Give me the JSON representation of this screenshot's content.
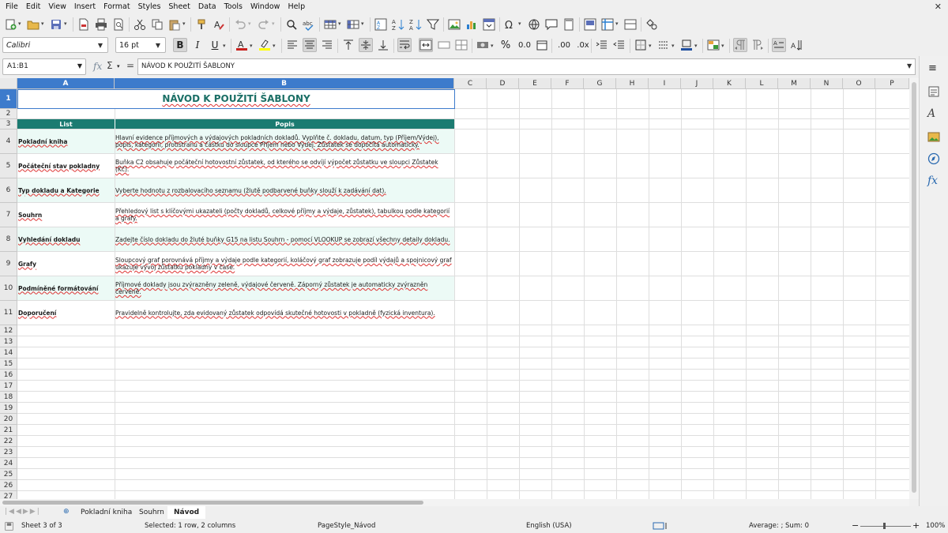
{
  "menu": [
    "File",
    "Edit",
    "View",
    "Insert",
    "Format",
    "Styles",
    "Sheet",
    "Data",
    "Tools",
    "Window",
    "Help"
  ],
  "font": {
    "name": "Calibri",
    "size": "16 pt"
  },
  "formula_bar": {
    "cell_ref": "A1:B1",
    "content": "NÁVOD K POUŽITÍ ŠABLONY"
  },
  "columns": [
    "A",
    "B",
    "C",
    "D",
    "E",
    "F",
    "G",
    "H",
    "I",
    "J",
    "K",
    "L",
    "M",
    "N",
    "O",
    "P"
  ],
  "rows": [
    "1",
    "2",
    "3",
    "4",
    "5",
    "6",
    "7",
    "8",
    "9",
    "10",
    "11",
    "12",
    "13",
    "14",
    "15",
    "16",
    "17",
    "18",
    "19",
    "20",
    "21",
    "22",
    "23",
    "24",
    "25",
    "26",
    "27"
  ],
  "sheet": {
    "title": "NÁVOD K POUŽITÍ ŠABLONY",
    "header": {
      "list": "List",
      "popis": "Popis"
    },
    "entries": [
      {
        "list": "Pokladní kniha",
        "popis": "Hlavní evidence příjmových a výdajových pokladních dokladů. Vyplňte č. dokladu, datum, typ (Příjem/Výdej), popis, kategorii, protistranu a částku do sloupce Příjem nebo Výdej. Zůstatek se dopočítá automaticky."
      },
      {
        "list": "Počáteční stav pokladny",
        "popis": "Buňka C2 obsahuje počáteční hotovostní zůstatek, od kterého se odvíjí výpočet zůstatku ve sloupci Zůstatek (Kč)."
      },
      {
        "list": "Typ dokladu a Kategorie",
        "popis": "Vyberte hodnotu z rozbalovacího seznamu (žlutě podbarvené buňky slouží k zadávání dat)."
      },
      {
        "list": "Souhrn",
        "popis": "Přehledový list s klíčovými ukazateli (počty dokladů, celkové příjmy a výdaje, zůstatek), tabulkou podle kategorií a grafy."
      },
      {
        "list": "Vyhledání dokladu",
        "popis": "Zadejte číslo dokladu do žluté buňky G15 na listu Souhrn - pomocí VLOOKUP se zobrazí všechny detaily dokladu."
      },
      {
        "list": "Grafy",
        "popis": "Sloupcový graf porovnává příjmy a výdaje podle kategorií, koláčový graf zobrazuje podíl výdajů a spojnicový graf ukazuje vývoj zůstatku pokladny v čase."
      },
      {
        "list": "Podmíněné formátování",
        "popis": "Příjmové doklady jsou zvýrazněny zeleně, výdajové červeně. Záporný zůstatek je automaticky zvýrazněn červeně."
      },
      {
        "list": "Doporučení",
        "popis": "Pravidelně kontrolujte, zda evidovaný zůstatek odpovídá skutečné hotovosti v pokladně (fyzická inventura)."
      }
    ]
  },
  "tabs": [
    "Pokladní kniha",
    "Souhrn",
    "Návod"
  ],
  "status": {
    "sheet": "Sheet 3 of 3",
    "selection": "Selected: 1 row, 2 columns",
    "page_style": "PageStyle_Návod",
    "language": "English (USA)",
    "summary": "Average: ; Sum: 0",
    "zoom": "100%"
  },
  "colors": {
    "header_band": "#1b7b71",
    "title": "#1b6f66",
    "alt_row": "#ecfaf6",
    "selection": "#3d7bcc"
  }
}
